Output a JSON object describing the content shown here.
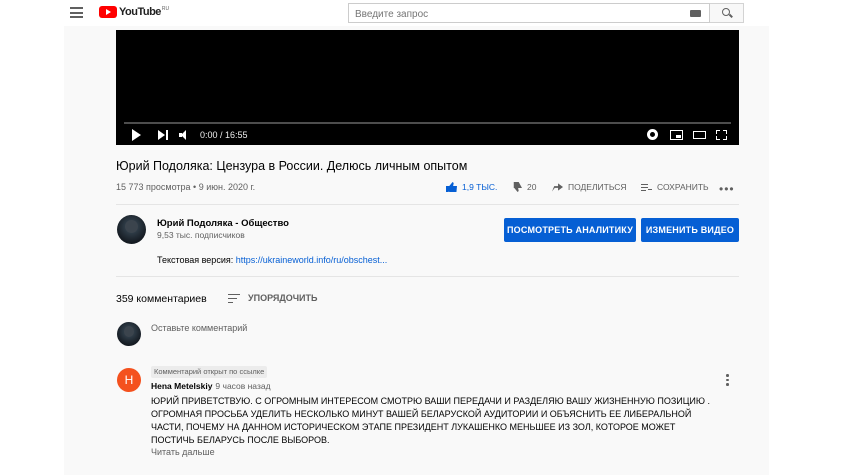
{
  "masthead": {
    "logo_text": "YouTube",
    "region": "RU",
    "search_placeholder": "Введите запрос"
  },
  "player": {
    "time": "0:00 / 16:55",
    "progress": 0
  },
  "video": {
    "title": "Юрий Подоляка: Цензура в России. Делюсь личным опытом",
    "meta": "15 773 просмотра • 9 июн. 2020 г.",
    "likes": "1,9 ТЫС.",
    "dislikes": "20",
    "share_label": "ПОДЕЛИТЬСЯ",
    "save_label": "СОХРАНИТЬ"
  },
  "channel": {
    "name": "Юрий Подоляка - Общество",
    "subscribers": "9,53 тыс. подписчиков",
    "analytics_label": "ПОСМОТРЕТЬ АНАЛИТИКУ",
    "edit_label": "ИЗМЕНИТЬ ВИДЕО"
  },
  "description": {
    "prefix": "Текстовая версия: ",
    "link": "https://ukraineworld.info/ru/obschest..."
  },
  "comments": {
    "count": "359 комментариев",
    "sort_label": "УПОРЯДОЧИТЬ",
    "input_placeholder": "Оставьте комментарий",
    "items": [
      {
        "pinned": "Комментарий открыт по ссылке",
        "avatar_letter": "H",
        "author": "Hena Metelskiy",
        "time": "9 часов назад",
        "text": "ЮРИЙ ПРИВЕТСТВУЮ. С ОГРОМНЫМ ИНТЕРЕСОМ СМОТРЮ ВАШИ ПЕРЕДАЧИ И РАЗДЕЛЯЮ ВАШУ ЖИЗНЕННУЮ ПОЗИЦИЮ . ОГРОМНАЯ ПРОСЬБА УДЕЛИТЬ НЕСКОЛЬКО МИНУТ ВАШЕЙ БЕЛАРУСКОЙ АУДИТОРИИ  И  ОБЪЯСНИТЬ ЕЕ ЛИБЕРАЛЬНОЙ ЧАСТИ, ПОЧЕМУ НА ДАННОМ ИСТОРИЧЕСКОМ ЭТАПЕ ПРЕЗИДЕНТ ЛУКАШЕНКО МЕНЬШЕЕ ИЗ ЗОЛ, КОТОРОЕ МОЖЕТ ПОСТИЧЬ БЕЛАРУСЬ ПОСЛЕ ВЫБОРОВ.",
        "read_more": "Читать дальше"
      }
    ]
  },
  "colors": {
    "accent": "#065fd4",
    "brand": "#ff0000",
    "avatar_h": "#f4511e"
  }
}
